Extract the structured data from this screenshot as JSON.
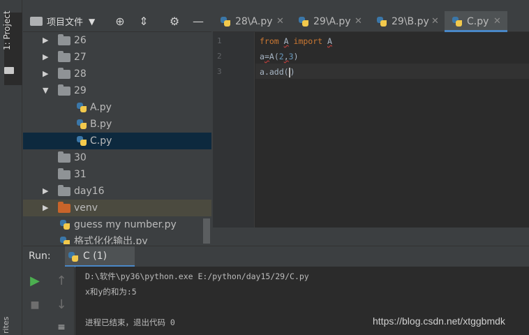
{
  "tool_strip": {
    "project_label": "1: Project",
    "favorites_label": "rites"
  },
  "project": {
    "title": "项目文件",
    "tree": [
      {
        "label": "26",
        "type": "folder",
        "expanded": false
      },
      {
        "label": "27",
        "type": "folder",
        "expanded": false
      },
      {
        "label": "28",
        "type": "folder",
        "expanded": false
      },
      {
        "label": "29",
        "type": "folder",
        "expanded": true
      },
      {
        "label": "A.py",
        "type": "file"
      },
      {
        "label": "B.py",
        "type": "file"
      },
      {
        "label": "C.py",
        "type": "file",
        "selected": true
      },
      {
        "label": "30",
        "type": "folder"
      },
      {
        "label": "31",
        "type": "folder"
      },
      {
        "label": "day16",
        "type": "folder",
        "expanded": false
      },
      {
        "label": "venv",
        "type": "folder",
        "expanded": false,
        "color": "#c8642a"
      },
      {
        "label": "guess my number.py",
        "type": "file"
      },
      {
        "label": "格式化化输出.py",
        "type": "file"
      }
    ]
  },
  "tabs": [
    {
      "label": "28\\A.py",
      "active": false
    },
    {
      "label": "29\\A.py",
      "active": false
    },
    {
      "label": "29\\B.py",
      "active": false
    },
    {
      "label": "C.py",
      "active": true
    }
  ],
  "editor": {
    "line_numbers": [
      "1",
      "2",
      "3"
    ],
    "lines": [
      {
        "kw1": "from",
        "mod": "A",
        "kw2": "import",
        "name": "A"
      },
      {
        "var": "a",
        "op": "=",
        "call": "A",
        "lp": "(",
        "n1": "2",
        "comma": ",",
        "n2": "3",
        "rp": ")"
      },
      {
        "obj": "a",
        "dot": ".",
        "method": "add",
        "lp": "(",
        "rp": ")"
      }
    ]
  },
  "run": {
    "label": "Run:",
    "tab_label": "C (1)",
    "output": [
      "D:\\软件\\py36\\python.exe E:/python/day15/29/C.py",
      "x和y的和为:5",
      "",
      "进程已结束，退出代码 0"
    ],
    "watermark": "https://blog.csdn.net/xtggbmdk"
  },
  "colors": {
    "accent": "#4a88c7",
    "selection": "#0d293e",
    "keyword": "#cc7832",
    "number": "#6897bb"
  }
}
